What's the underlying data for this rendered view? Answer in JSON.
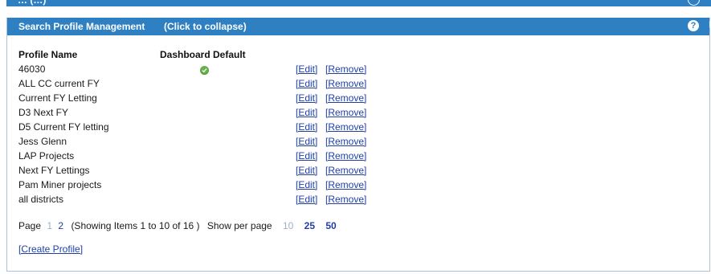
{
  "previous_panel": {
    "title": "… (…)"
  },
  "panel": {
    "title": "Search Profile Management",
    "collapse_label": "(Click to collapse)",
    "help_icon": "question-circle-icon",
    "help_glyph": "?"
  },
  "table": {
    "columns": [
      "Profile Name",
      "Dashboard Default"
    ],
    "rows": [
      {
        "name": "46030",
        "dashboard_default": true,
        "edit": "[Edit]",
        "remove": "[Remove]"
      },
      {
        "name": "ALL CC current FY",
        "dashboard_default": false,
        "edit": "[Edit]",
        "remove": "[Remove]"
      },
      {
        "name": "Current FY Letting",
        "dashboard_default": false,
        "edit": "[Edit]",
        "remove": "[Remove]"
      },
      {
        "name": "D3 Next FY",
        "dashboard_default": false,
        "edit": "[Edit]",
        "remove": "[Remove]"
      },
      {
        "name": "D5 Current FY letting",
        "dashboard_default": false,
        "edit": "[Edit]",
        "remove": "[Remove]"
      },
      {
        "name": "Jess Glenn",
        "dashboard_default": false,
        "edit": "[Edit]",
        "remove": "[Remove]"
      },
      {
        "name": "LAP Projects",
        "dashboard_default": false,
        "edit": "[Edit]",
        "remove": "[Remove]"
      },
      {
        "name": "Next FY Lettings",
        "dashboard_default": false,
        "edit": "[Edit]",
        "remove": "[Remove]"
      },
      {
        "name": "Pam Miner projects",
        "dashboard_default": false,
        "edit": "[Edit]",
        "remove": "[Remove]"
      },
      {
        "name": "all districts",
        "dashboard_default": false,
        "edit": "[Edit]",
        "remove": "[Remove]"
      }
    ]
  },
  "pager": {
    "page_label": "Page",
    "current_page": "1",
    "other_page": "2",
    "showing_text": "(Showing Items 1 to 10 of 16 )",
    "per_page_label": "Show per page",
    "per_page_current": "10",
    "per_page_options": [
      "25",
      "50"
    ]
  },
  "create_profile": "[Create Profile]",
  "colors": {
    "header_bg": "#2f80c3",
    "link": "#1f3fa8",
    "muted": "#9fb0c8",
    "default_check": "#6ab04c"
  }
}
